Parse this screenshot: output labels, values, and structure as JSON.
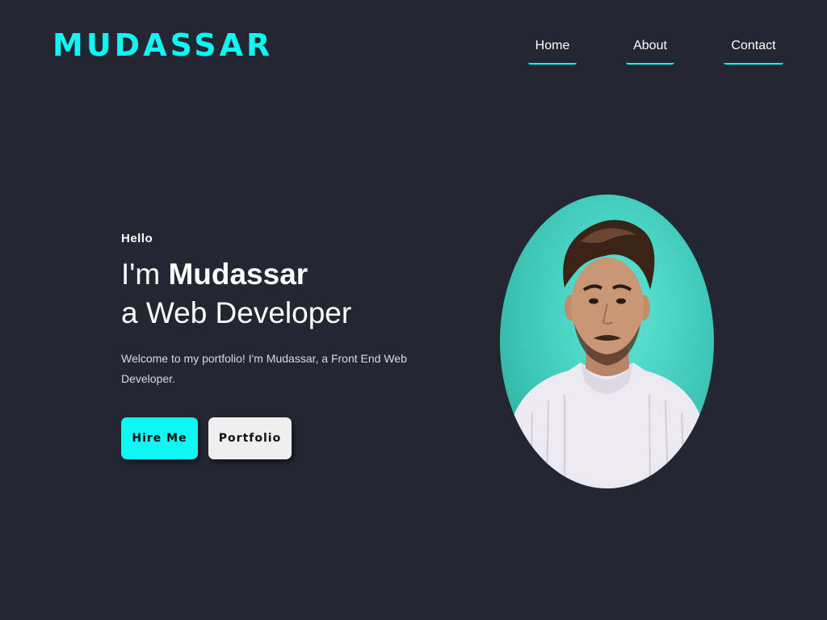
{
  "header": {
    "logo": "MUDASSAR",
    "nav": [
      {
        "label": "Home"
      },
      {
        "label": "About"
      },
      {
        "label": "Contact"
      }
    ]
  },
  "hero": {
    "greeting": "Hello",
    "headline_prefix": "I'm ",
    "name": "Mudassar",
    "role_line": "a Web Developer",
    "intro": "Welcome to my portfolio! I'm Mudassar, a Front End Web Developer.",
    "buttons": {
      "hire": "Hire Me",
      "portfolio": "Portfolio"
    }
  },
  "colors": {
    "background": "#222732",
    "accent": "#0ff7f3",
    "portrait_bg": "#3fc8b9"
  }
}
